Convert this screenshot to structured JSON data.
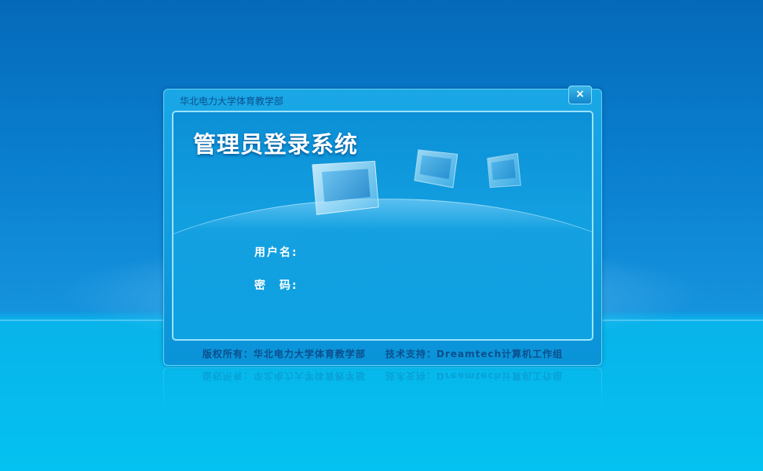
{
  "window": {
    "title": "华北电力大学体育教学部",
    "close_label": "×"
  },
  "login": {
    "heading": "管理员登录系统",
    "username_label": "用户名:",
    "password_label": "密　码:",
    "username_value": "",
    "password_value": ""
  },
  "footer": {
    "copyright": "版权所有：华北电力大学体育教学部",
    "support": "技术支持：Dreamtech计算机工作组"
  },
  "colors": {
    "background": "#0a7fcf",
    "dialog": "#1aa7e6",
    "footer_text": "#0c4f8e"
  }
}
